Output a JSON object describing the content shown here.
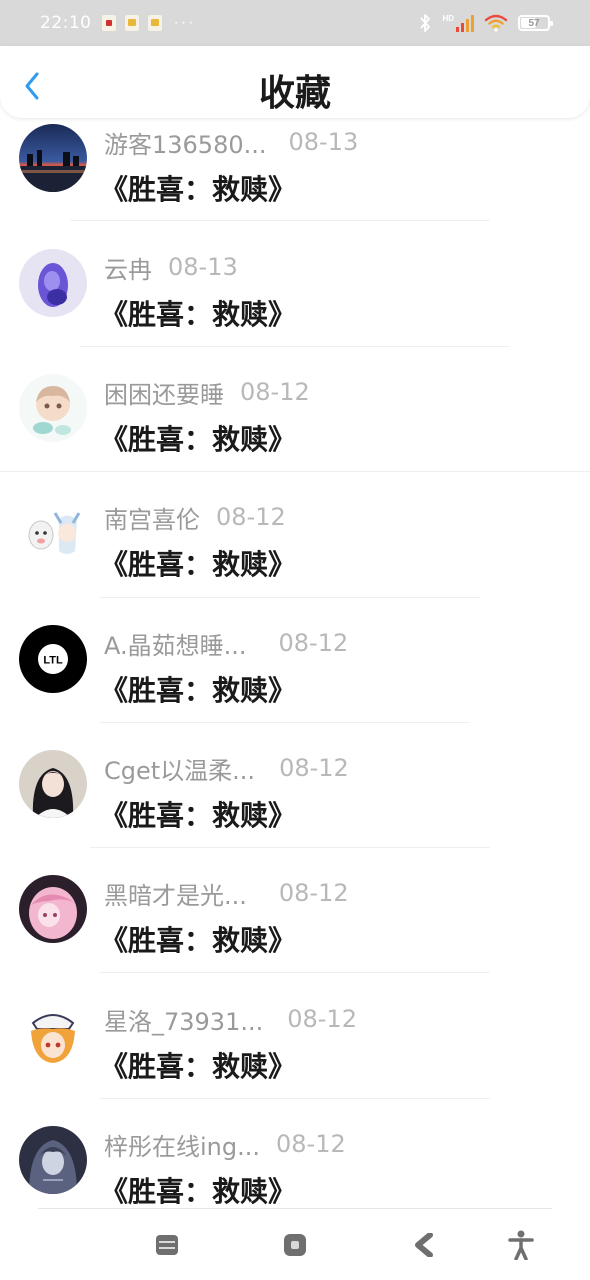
{
  "status_bar": {
    "time": "22:10",
    "dots": "···",
    "battery": "57",
    "network_badge": "HD"
  },
  "header": {
    "title": "收藏",
    "back_icon": "chevron-left-icon",
    "accent_color": "#2e9bf0"
  },
  "favorites": [
    {
      "name": "游客136580...",
      "date": "08-13",
      "title": "《胜喜：救赎》",
      "avatar": "night-city-photo"
    },
    {
      "name": "云冉",
      "date": "08-13",
      "title": "《胜喜：救赎》",
      "avatar": "purple-anime-character"
    },
    {
      "name": "困困还要睡",
      "date": "08-12",
      "title": "《胜喜：救赎》",
      "avatar": "anime-boy-sticker"
    },
    {
      "name": "南宫喜伦",
      "date": "08-12",
      "title": "《胜喜：救赎》",
      "avatar": "goat-and-anime-girl"
    },
    {
      "name": "A.晶茹想睡...",
      "date": "08-12",
      "title": "《胜喜：救赎》",
      "avatar": "ltl-logo"
    },
    {
      "name": "Cget以温柔...",
      "date": "08-12",
      "title": "《胜喜：救赎》",
      "avatar": "girl-photo"
    },
    {
      "name": "黑暗才是光...",
      "date": "08-12",
      "title": "《胜喜：救赎》",
      "avatar": "pink-hair-anime"
    },
    {
      "name": "星洛_73931...",
      "date": "08-12",
      "title": "《胜喜：救赎》",
      "avatar": "orange-hair-anime"
    },
    {
      "name": "梓彤在线ing...",
      "date": "08-12",
      "title": "《胜喜：救赎》",
      "avatar": "dark-anime-girl"
    }
  ],
  "nav_bar": {
    "menu_icon": "menu-icon",
    "home_icon": "home-icon",
    "back_icon": "back-icon",
    "accessibility_icon": "accessibility-icon"
  }
}
